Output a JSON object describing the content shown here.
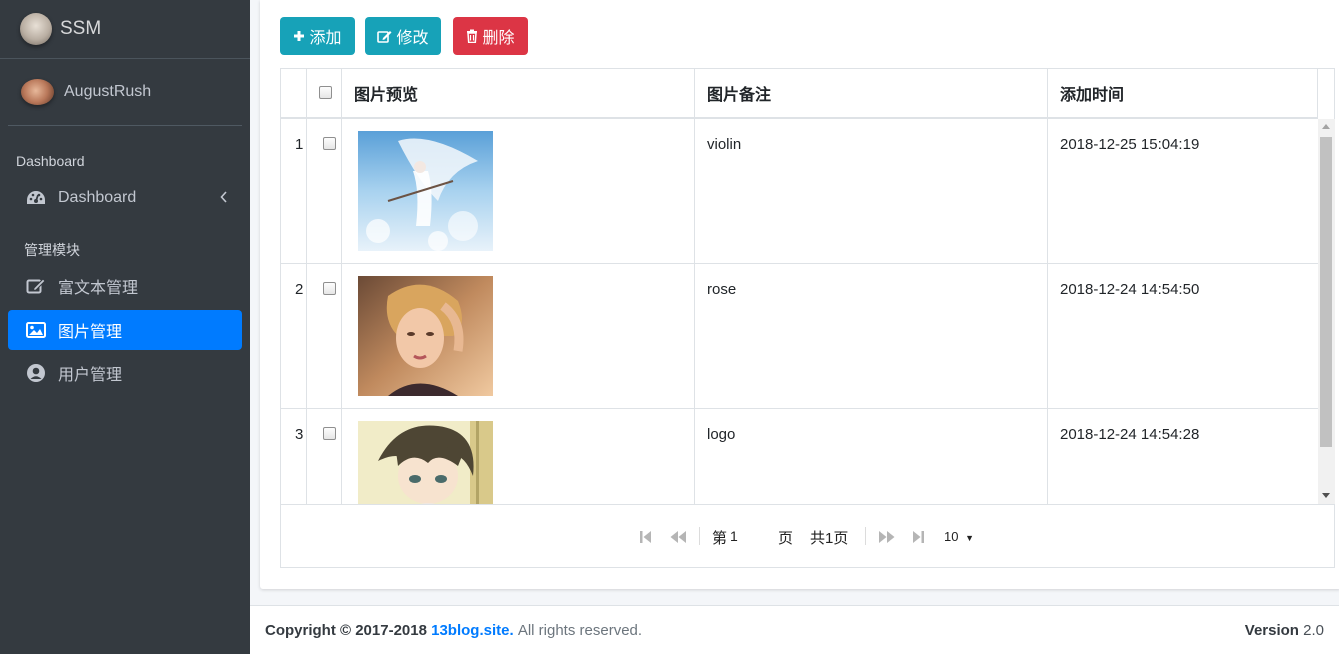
{
  "brand": {
    "name": "SSM"
  },
  "user": {
    "name": "AugustRush"
  },
  "sidebar": {
    "header1": "Dashboard",
    "dashboard_label": "Dashboard",
    "header2": "管理模块",
    "items": [
      {
        "label": "富文本管理",
        "icon": "edit-icon"
      },
      {
        "label": "图片管理",
        "icon": "image-icon",
        "active": true
      },
      {
        "label": "用户管理",
        "icon": "user-circle-icon"
      }
    ]
  },
  "toolbar": {
    "add_label": "添加",
    "edit_label": "修改",
    "delete_label": "删除"
  },
  "table": {
    "columns": [
      "图片预览",
      "图片备注",
      "添加时间"
    ],
    "rows": [
      {
        "index": "1",
        "note": "violin",
        "time": "2018-12-25 15:04:19"
      },
      {
        "index": "2",
        "note": "rose",
        "time": "2018-12-24 14:54:50"
      },
      {
        "index": "3",
        "note": "logo",
        "time": "2018-12-24 14:54:28"
      }
    ]
  },
  "pager": {
    "page_prefix": "第",
    "page_value": "1",
    "page_suffix": "页",
    "total": "共1页",
    "page_size": "10"
  },
  "footer": {
    "copyright": "Copyright © 2017-2018",
    "site": "13blog.site.",
    "rights": "All rights reserved.",
    "version_label": "Version",
    "version_value": "2.0"
  },
  "colors": {
    "sidebar_bg": "#343a40",
    "active": "#007bff",
    "info": "#17a2b8",
    "danger": "#dc3545"
  }
}
